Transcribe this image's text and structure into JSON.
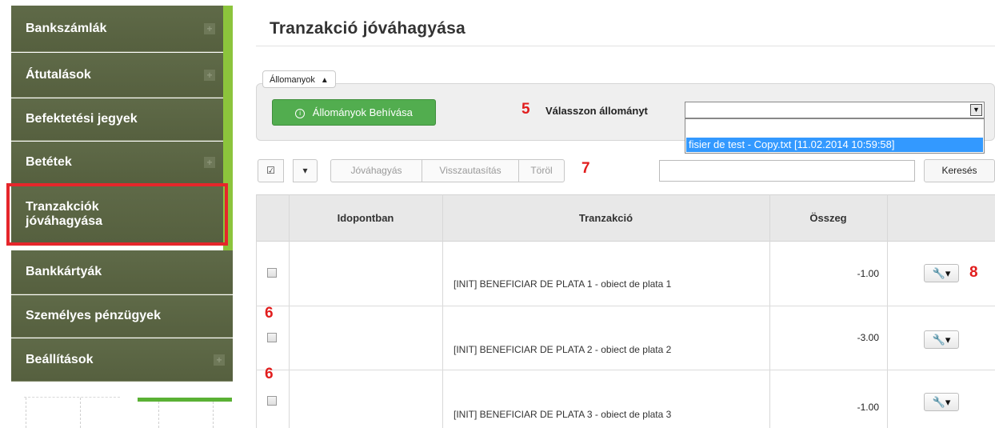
{
  "sidebar": {
    "items": [
      {
        "label": "Bankszámlák",
        "has_plus": true
      },
      {
        "label": "Átutalások",
        "has_plus": true
      },
      {
        "label": "Befektetési jegyek",
        "has_plus": false
      },
      {
        "label": "Betétek",
        "has_plus": true
      },
      {
        "label": "Tranzakciók jóváhagyása",
        "has_plus": false
      },
      {
        "label": "Bankkártyák",
        "has_plus": false
      },
      {
        "label": "Személyes pénzügyek",
        "has_plus": false
      },
      {
        "label": "Beállítások",
        "has_plus": true
      }
    ],
    "plus_glyph": "+"
  },
  "page": {
    "title": "Tranzakció jóváhagyása"
  },
  "files": {
    "tab_label": "Állomanyok",
    "tab_caret": "▲",
    "load_button": "Állományok Behívása",
    "load_icon": "info-icon",
    "select_label": "Válasszon állományt",
    "select_value": "",
    "dropdown_option": "fisier de test - Copy.txt [11.02.2014 10:59:58]"
  },
  "toolbar": {
    "check_icon": "☑",
    "caret": "▾",
    "approve": "Jóváhagyás",
    "reject": "Visszautasítás",
    "delete": "Töröl",
    "search_value": "",
    "search_button": "Keresés"
  },
  "table": {
    "headers": [
      "",
      "Idopontban",
      "Tranzakció",
      "Összeg",
      ""
    ],
    "rows": [
      {
        "checked": false,
        "time": "",
        "transaction": "[INIT] BENEFICIAR DE PLATA 1 - obiect de plata 1",
        "amount": "-1.00",
        "action": "🔧▾"
      },
      {
        "checked": false,
        "time": "",
        "transaction": "[INIT] BENEFICIAR DE PLATA 2 - obiect de plata 2",
        "amount": "-3.00",
        "action": "🔧▾"
      },
      {
        "checked": false,
        "time": "",
        "transaction": "[INIT] BENEFICIAR DE PLATA 3 - obiect de plata 3",
        "amount": "-1.00",
        "action": "🔧▾"
      }
    ]
  },
  "annotations": {
    "a5": "5",
    "a6": "6",
    "a6b": "6",
    "a7": "7",
    "a8": "8"
  },
  "colors": {
    "sidebar_bg": "#5f6a48",
    "accent_green": "#8cc43c",
    "button_green": "#52ad4f",
    "highlight_red": "#e5262b",
    "select_blue": "#3399ff"
  }
}
